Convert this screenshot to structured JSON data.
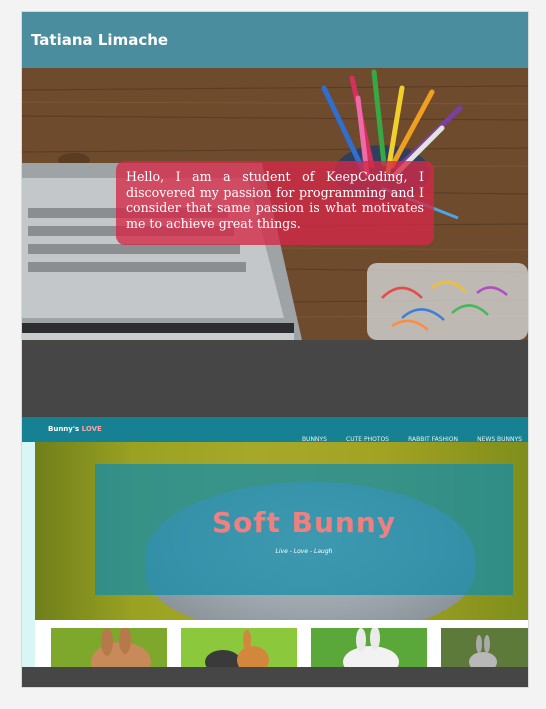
{
  "header": {
    "title": "Tatiana Limache"
  },
  "hero": {
    "bio_text": "Hello, I am a student of KeepCoding, I discovered my passion for programming and I consider that same passion is what motivates me to achieve great things."
  },
  "project_preview": {
    "logo_main": "Bunny's ",
    "logo_accent": "LOVE",
    "nav_links": [
      "BUNNYS",
      "CUTE PHOTOS",
      "RABBIT FASHION",
      "NEWS BUNNYS"
    ],
    "heading": "Soft Bunny",
    "tagline": "Live - Love - Laugh"
  },
  "colors": {
    "topbar": "#4a8d9e",
    "bio_box": "#d52846",
    "preview_nav": "#158193",
    "preview_heading": "#f08080"
  }
}
